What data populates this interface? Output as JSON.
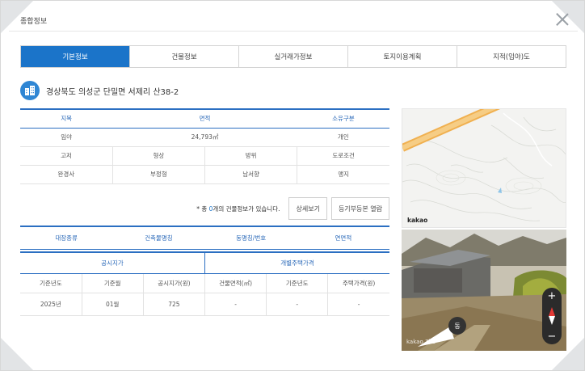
{
  "window": {
    "title": "종합정보"
  },
  "tabs": [
    {
      "label": "기본정보",
      "active": true
    },
    {
      "label": "건물정보",
      "active": false
    },
    {
      "label": "실거래가정보",
      "active": false
    },
    {
      "label": "토지이용계획",
      "active": false
    },
    {
      "label": "지적(임야)도",
      "active": false
    }
  ],
  "address": "경상북도 의성군 단밀면 서제리 산38-2",
  "land": {
    "headers": {
      "jimok": "지목",
      "area": "면적",
      "ownership": "소유구분"
    },
    "values": {
      "jimok": "임야",
      "area": "24,793㎡",
      "ownership": "개인"
    },
    "headers2": [
      "고저",
      "형상",
      "방위",
      "도로조건"
    ],
    "values2": [
      "완경사",
      "부정형",
      "남서향",
      "맹지"
    ]
  },
  "building": {
    "note_prefix": "* 총 ",
    "count": "0",
    "note_suffix": "개의 건물정보가 있습니다.",
    "detail_button": "상세보기",
    "registry_button": "등기부등본 열람",
    "headers": [
      "대장종류",
      "건축물명칭",
      "동명칭/번호",
      "연면적"
    ]
  },
  "price": {
    "group_left": "공시지가",
    "group_right": "개별주택가격",
    "headers": [
      "기준년도",
      "기준월",
      "공시지가(원)",
      "건물면적(㎡)",
      "기준년도",
      "주택가격(원)"
    ],
    "values": [
      "2025년",
      "01월",
      "725",
      "-",
      "-",
      "-"
    ]
  },
  "map": {
    "label": "kakao",
    "accent_color": "#f0b050"
  },
  "roadview": {
    "watermark": "kakao 지도",
    "direction_badge": "동",
    "zoom_in": "+",
    "zoom_out": "−"
  },
  "colors": {
    "primary": "#1b74c9",
    "header_blue": "#2968b8"
  }
}
